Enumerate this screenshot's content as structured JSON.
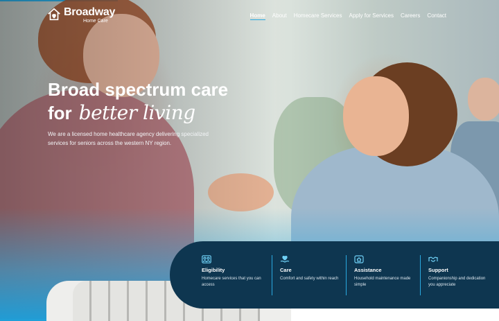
{
  "brand": {
    "name": "Broadway",
    "tagline": "Home Care"
  },
  "nav": {
    "items": [
      {
        "label": "Home",
        "active": true
      },
      {
        "label": "About",
        "active": false
      },
      {
        "label": "Homecare Services",
        "active": false
      },
      {
        "label": "Apply for Services",
        "active": false
      },
      {
        "label": "Careers",
        "active": false
      },
      {
        "label": "Contact",
        "active": false
      }
    ]
  },
  "hero": {
    "headline_line1": "Broad spectrum care",
    "headline_for": "for",
    "headline_script": "better living",
    "subtext": "We are a licensed home healthcare agency delivering specialized services for seniors across the western NY region."
  },
  "features": [
    {
      "icon": "people-icon",
      "title": "Eligibility",
      "desc": "Homecare services that you can access"
    },
    {
      "icon": "heart-hand-icon",
      "title": "Care",
      "desc": "Comfort and safety within reach"
    },
    {
      "icon": "home-icon",
      "title": "Assistance",
      "desc": "Household maintenance made simple"
    },
    {
      "icon": "handshake-icon",
      "title": "Support",
      "desc": "Companionship and dedication you appreciate"
    }
  ],
  "colors": {
    "accent": "#2aa9e0",
    "panel": "#0e3650"
  }
}
